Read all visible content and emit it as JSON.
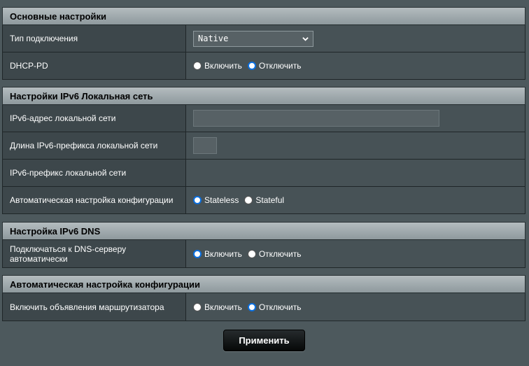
{
  "basic": {
    "title": "Основные настройки",
    "connection_type_label": "Тип подключения",
    "connection_type_value": "Native",
    "dhcp_pd_label": "DHCP-PD",
    "enable_label": "Включить",
    "disable_label": "Отключить",
    "dhcp_pd_selected": "disable"
  },
  "lan": {
    "title": "Настройки IPv6 Локальная сеть",
    "address_label": "IPv6-адрес локальной сети",
    "address_value": "",
    "prefix_len_label": "Длина IPv6-префикса локальной сети",
    "prefix_len_value": "",
    "prefix_label": "IPv6-префикс локальной сети",
    "autoconf_label": "Автоматическая настройка конфигурации",
    "stateless_label": "Stateless",
    "stateful_label": "Stateful",
    "autoconf_selected": "stateless"
  },
  "dns": {
    "title": "Настройка IPv6 DNS",
    "auto_label": "Подключаться к DNS-серверу автоматически",
    "enable_label": "Включить",
    "disable_label": "Отключить",
    "auto_selected": "enable"
  },
  "autoconf": {
    "title": "Автоматическая настройка конфигурации",
    "router_adv_label": "Включить объявления маршрутизатора",
    "enable_label": "Включить",
    "disable_label": "Отключить",
    "router_adv_selected": "disable"
  },
  "apply_button": "Применить",
  "colors": {
    "background": "#4d595d",
    "header": "#a1abaf",
    "radio_accent": "#0a6fe0"
  }
}
